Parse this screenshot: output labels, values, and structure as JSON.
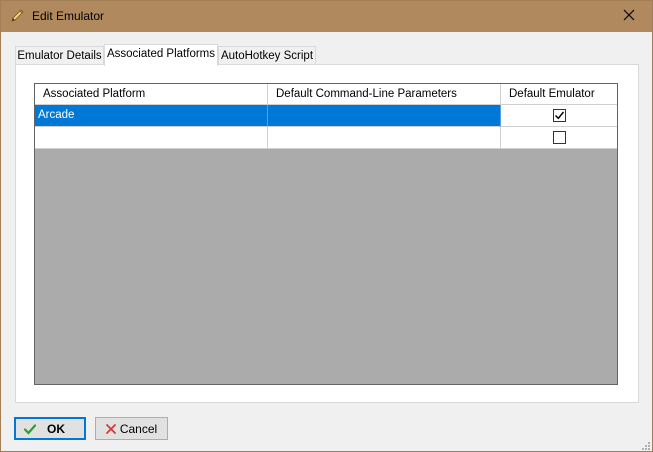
{
  "window": {
    "title": "Edit Emulator",
    "colors": {
      "titlebar": "#b08a5e",
      "selection": "#0078d7"
    }
  },
  "tabs": [
    {
      "label": "Emulator Details",
      "active": false
    },
    {
      "label": "Associated Platforms",
      "active": true
    },
    {
      "label": "AutoHotkey Script",
      "active": false
    }
  ],
  "grid": {
    "columns": [
      "Associated Platform",
      "Default Command-Line Parameters",
      "Default Emulator"
    ],
    "rows": [
      {
        "platform": "Arcade",
        "params": "",
        "default_emulator": true,
        "selected": true
      },
      {
        "platform": "",
        "params": "",
        "default_emulator": false,
        "selected": false
      }
    ]
  },
  "buttons": {
    "ok_label": "OK",
    "cancel_label": "Cancel"
  },
  "icons": {
    "title": "pencil-icon",
    "close": "close-icon",
    "ok": "checkmark-icon",
    "cancel": "x-icon"
  }
}
